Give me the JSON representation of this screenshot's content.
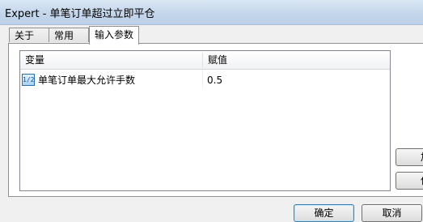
{
  "window": {
    "title": "Expert - 单笔订单超过立即平仓"
  },
  "tabs": [
    {
      "label": "关于"
    },
    {
      "label": "常用"
    },
    {
      "label": "输入参数"
    }
  ],
  "table": {
    "columns": [
      "变量",
      "赋值"
    ],
    "rows": [
      {
        "icon": "variable-icon",
        "name": "单笔订单最大允许手数",
        "value": "0.5"
      }
    ]
  },
  "side_buttons": [
    {
      "label": "加"
    },
    {
      "label": "保"
    }
  ],
  "buttons": {
    "ok": "确定",
    "cancel": "取消"
  }
}
